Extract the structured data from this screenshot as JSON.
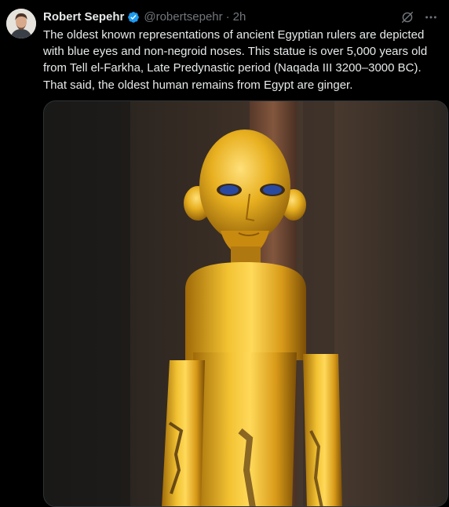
{
  "tweet": {
    "author": {
      "display_name": "Robert Sepehr",
      "handle": "@robertsepehr",
      "verified": true,
      "avatar_icon": "profile-photo"
    },
    "separator": "·",
    "time": "2h",
    "text": "The oldest known representations of ancient Egyptian rulers are depicted with blue eyes and non-negroid noses. This statue is over 5,000 years old from Tell el-Farkha, Late Predynastic period (Naqada III 3200–3000 BC). That said, the oldest human remains from Egypt are ginger.",
    "actions": {
      "grok_icon": "grok-icon",
      "more_icon": "more-icon"
    },
    "media": {
      "kind": "photo"
    }
  },
  "colors": {
    "background": "#000000",
    "text_primary": "#e7e9ea",
    "text_secondary": "#71767b",
    "verified_blue": "#1d9bf0",
    "border": "#2f3336"
  }
}
